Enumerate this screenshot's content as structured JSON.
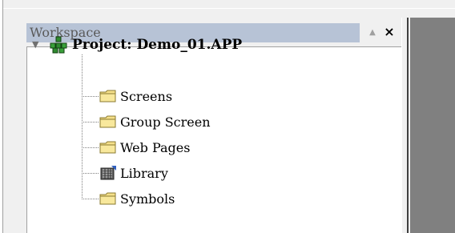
{
  "workspace": {
    "title": "Workspace",
    "pin_icon": "pin-up-arrow",
    "close_icon": "close-x",
    "pin_glyph": "▲",
    "close_glyph": "×"
  },
  "tree": {
    "root": {
      "label": "Project: Demo_01.APP",
      "icon": "project-tree-icon",
      "expanded": true,
      "expand_glyph": "▼"
    },
    "children": [
      {
        "label": "Screens",
        "icon": "folder-icon"
      },
      {
        "label": "Group Screen",
        "icon": "folder-icon"
      },
      {
        "label": "Web Pages",
        "icon": "folder-icon"
      },
      {
        "label": "Library",
        "icon": "library-icon"
      },
      {
        "label": "Symbols",
        "icon": "folder-icon"
      }
    ]
  },
  "colors": {
    "title_bar": "#b7c3d6",
    "title_text": "#5a5a5a",
    "folder_fill": "#f5e08a",
    "folder_edge": "#8a7a30",
    "right_panel": "#808080",
    "background": "#f0f0f0"
  }
}
